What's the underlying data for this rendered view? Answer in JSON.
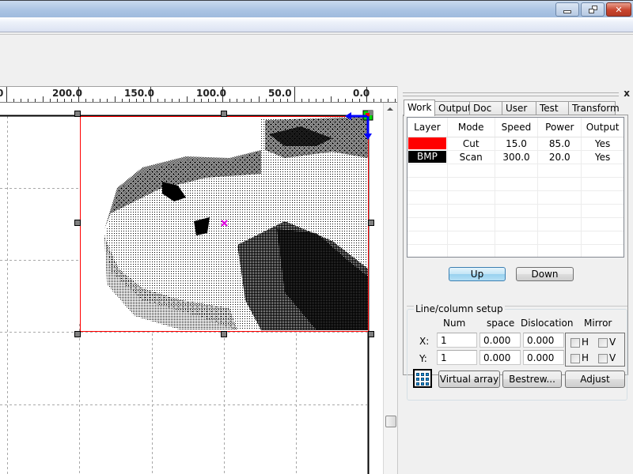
{
  "window": {
    "controls": {
      "minimize_icon": "minimize-icon",
      "restore_icon": "restore-icon",
      "close_icon": "close-icon"
    }
  },
  "ruler": {
    "labels": [
      "0",
      "200.0",
      "150.0",
      "100.0",
      "50.0",
      "0.0"
    ]
  },
  "canvas": {
    "image_description": "dithered black-and-white photo of a reclining woman (BMP layer)",
    "selection_color": "#ff0000",
    "origin_marker_colors": {
      "arrow": "#0000ff",
      "origin": "#ff0000",
      "handle": "#00dd00"
    },
    "center_marker_color": "#e000e0"
  },
  "panel": {
    "close_label": "x",
    "tabs": [
      {
        "label": "Work",
        "active": true
      },
      {
        "label": "Output",
        "active": false
      },
      {
        "label": "Doc",
        "active": false
      },
      {
        "label": "User",
        "active": false
      },
      {
        "label": "Test",
        "active": false
      },
      {
        "label": "Transform",
        "active": false
      }
    ],
    "layer_table": {
      "headers": [
        "Layer",
        "Mode",
        "Speed",
        "Power",
        "Output"
      ],
      "rows": [
        {
          "layer": "",
          "layer_color": "#ff0000",
          "layer_text_color": "#ffffff",
          "mode": "Cut",
          "speed": "15.0",
          "power": "85.0",
          "output": "Yes"
        },
        {
          "layer": "BMP",
          "layer_color": "#000000",
          "layer_text_color": "#ffffff",
          "mode": "Scan",
          "speed": "300.0",
          "power": "20.0",
          "output": "Yes"
        }
      ]
    },
    "up_label": "Up",
    "down_label": "Down",
    "line_column": {
      "title": "Line/column setup",
      "col_num": "Num",
      "col_space": "space",
      "col_dislocation": "Dislocation",
      "col_mirror": "Mirror",
      "x_label": "X:",
      "y_label": "Y:",
      "x": {
        "num": "1",
        "space": "0.000",
        "dislocation": "0.000",
        "mirror_h": false,
        "mirror_v": false
      },
      "y": {
        "num": "1",
        "space": "0.000",
        "dislocation": "0.000",
        "mirror_h": false,
        "mirror_v": false
      },
      "h_label": "H",
      "v_label": "V",
      "virtual_array_label": "Virtual array",
      "bestrew_label": "Bestrew...",
      "adjust_label": "Adjust"
    }
  }
}
